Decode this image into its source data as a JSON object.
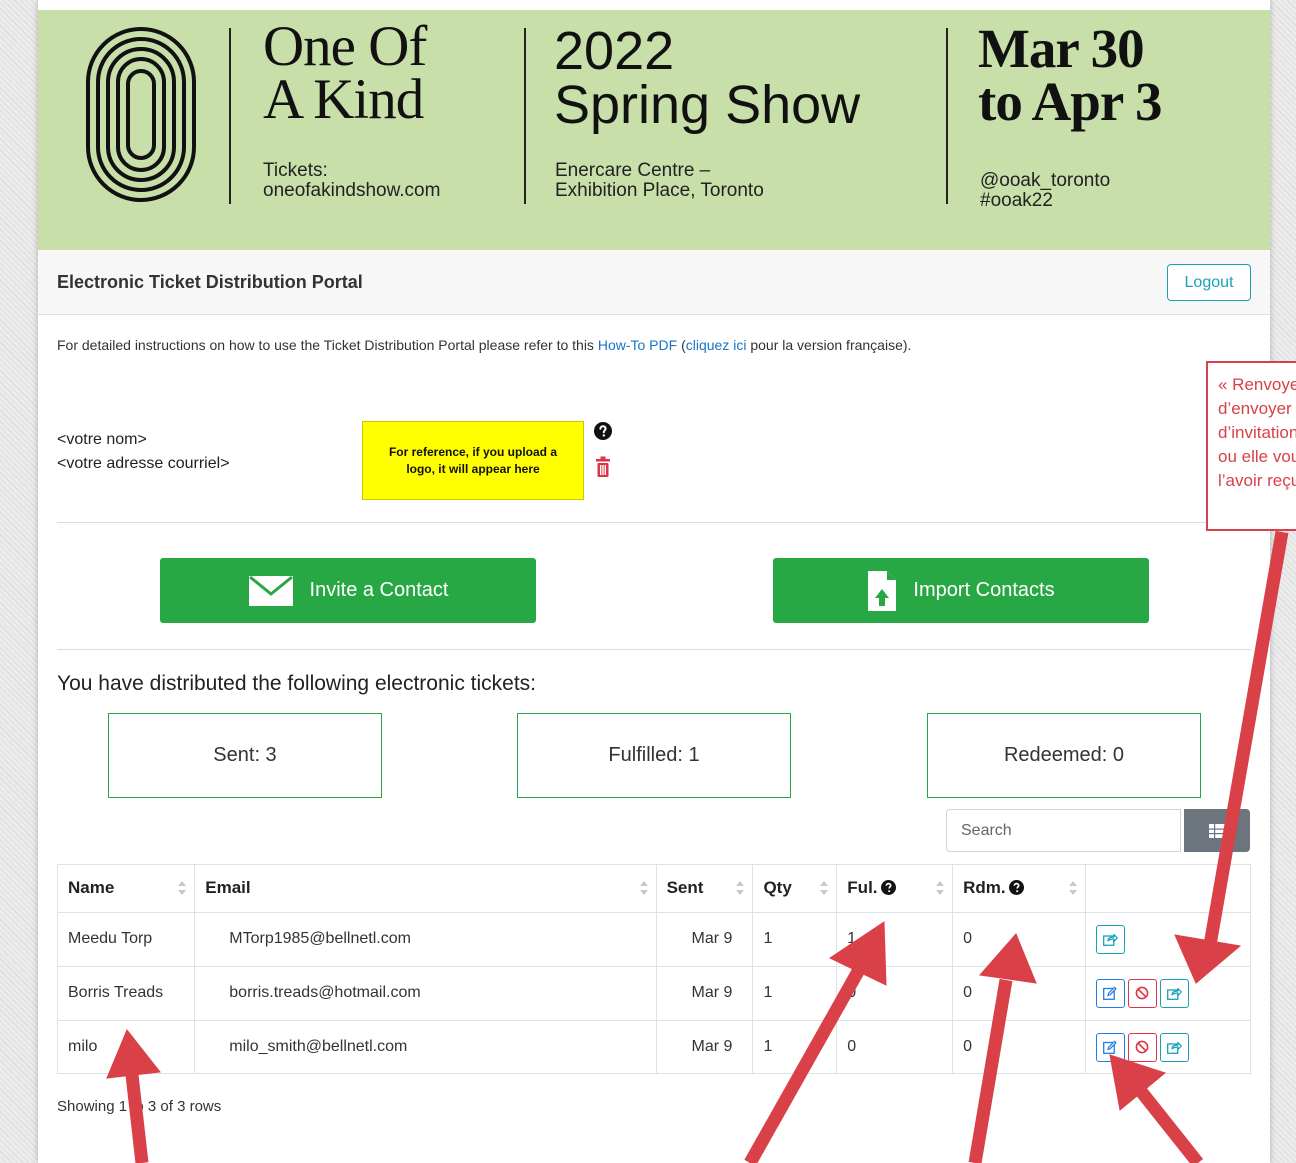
{
  "banner": {
    "brand_line1": "One Of",
    "brand_line2": "A Kind",
    "tickets_label": "Tickets:",
    "tickets_url": "oneofakindshow.com",
    "year": "2022",
    "show_name": "Spring Show",
    "venue_line1": "Enercare Centre –",
    "venue_line2": "Exhibition Place, Toronto",
    "dates_line1": "Mar 30",
    "dates_line2": "to Apr 3",
    "handle": "@ooak_toronto",
    "hashtag": "#ooak22",
    "bg_color": "#c8dfaa"
  },
  "header": {
    "title": "Electronic Ticket Distribution Portal",
    "logout_label": "Logout"
  },
  "instructions": {
    "prefix": "For detailed instructions on how to use the Ticket Distribution Portal please refer to this ",
    "link1": "How-To PDF",
    "middle": " (",
    "link2": "cliquez ici",
    "suffix": " pour la version française)."
  },
  "user": {
    "name": "<votre nom>",
    "email": "<votre adresse courriel>",
    "logo_placeholder": "For reference, if you upload a logo, it will appear here"
  },
  "actions": {
    "invite_label": "Invite a Contact",
    "import_label": "Import Contacts"
  },
  "distribution": {
    "title": "You have distributed the following electronic tickets:",
    "sent": "Sent: 3",
    "fulfilled": "Fulfilled: 1",
    "redeemed": "Redeemed: 0"
  },
  "search": {
    "placeholder": "Search"
  },
  "table": {
    "headers": {
      "name": "Name",
      "email": "Email",
      "sent": "Sent",
      "qty": "Qty",
      "ful": "Ful.",
      "rdm": "Rdm."
    },
    "rows": [
      {
        "name": "Meedu Torp",
        "email": "MTorp1985@bellnetl.com",
        "sent": "Mar 9",
        "qty": "1",
        "ful": "1",
        "rdm": "0"
      },
      {
        "name": "Borris Treads",
        "email": "borris.treads@hotmail.com",
        "sent": "Mar 9",
        "qty": "1",
        "ful": "0",
        "rdm": "0"
      },
      {
        "name": "milo",
        "email": "milo_smith@bellnetl.com",
        "sent": "Mar 9",
        "qty": "1",
        "ful": "0",
        "rdm": "0"
      }
    ]
  },
  "footer": {
    "showing": "Showing 1 to 3 of 3 rows"
  },
  "annotation": {
    "lines": [
      "« Renvoyer » vous pe",
      "d’envoyer à nouveau",
      "d’invitation à votre in",
      "ou elle vous indique",
      "l’avoir reçu ou l’avoir"
    ],
    "color": "#d94048"
  },
  "colors": {
    "green": "#28a745",
    "teal": "#17a2b8",
    "red": "#dc3545",
    "blue": "#1f7ee6"
  }
}
